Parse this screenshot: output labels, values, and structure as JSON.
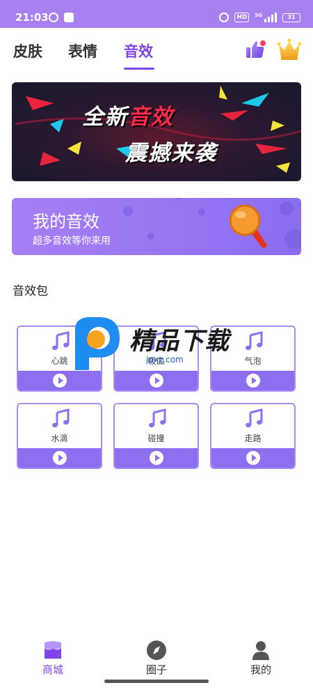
{
  "status_bar": {
    "time": "21:03",
    "hd_badge": "HD",
    "network": "5G",
    "battery": "31"
  },
  "tabs": [
    {
      "label": "皮肤",
      "active": false
    },
    {
      "label": "表情",
      "active": false
    },
    {
      "label": "音效",
      "active": true
    }
  ],
  "header_icons": [
    "thumb-up-icon",
    "crown-icon"
  ],
  "banner": {
    "line1_prefix": "全新",
    "line1_highlight": "音效",
    "line2": "震撼来袭"
  },
  "my_effects": {
    "title": "我的音效",
    "subtitle": "超多音效等你来用",
    "icon": "microphone-icon"
  },
  "section_title": "音效包",
  "sound_packs": [
    {
      "label": "心跳",
      "icon": "music-note-icon"
    },
    {
      "label": "吸血",
      "icon": "music-note-icon"
    },
    {
      "label": "气泡",
      "icon": "music-note-icon"
    },
    {
      "label": "水滴",
      "icon": "music-note-icon"
    },
    {
      "label": "碰撞",
      "icon": "music-note-icon"
    },
    {
      "label": "走路",
      "icon": "music-note-icon"
    }
  ],
  "watermark": {
    "title": "精品下载",
    "domain": "jpxz.com"
  },
  "bottom_nav": [
    {
      "label": "商城",
      "icon": "store-icon",
      "active": true
    },
    {
      "label": "圈子",
      "icon": "compass-icon",
      "active": false
    },
    {
      "label": "我的",
      "icon": "profile-icon",
      "active": false
    }
  ],
  "colors": {
    "accent": "#7f45e8",
    "status_bar": "#a880f0",
    "card_bar": "#8d6ff0",
    "banner_highlight": "#ff2a4a"
  }
}
